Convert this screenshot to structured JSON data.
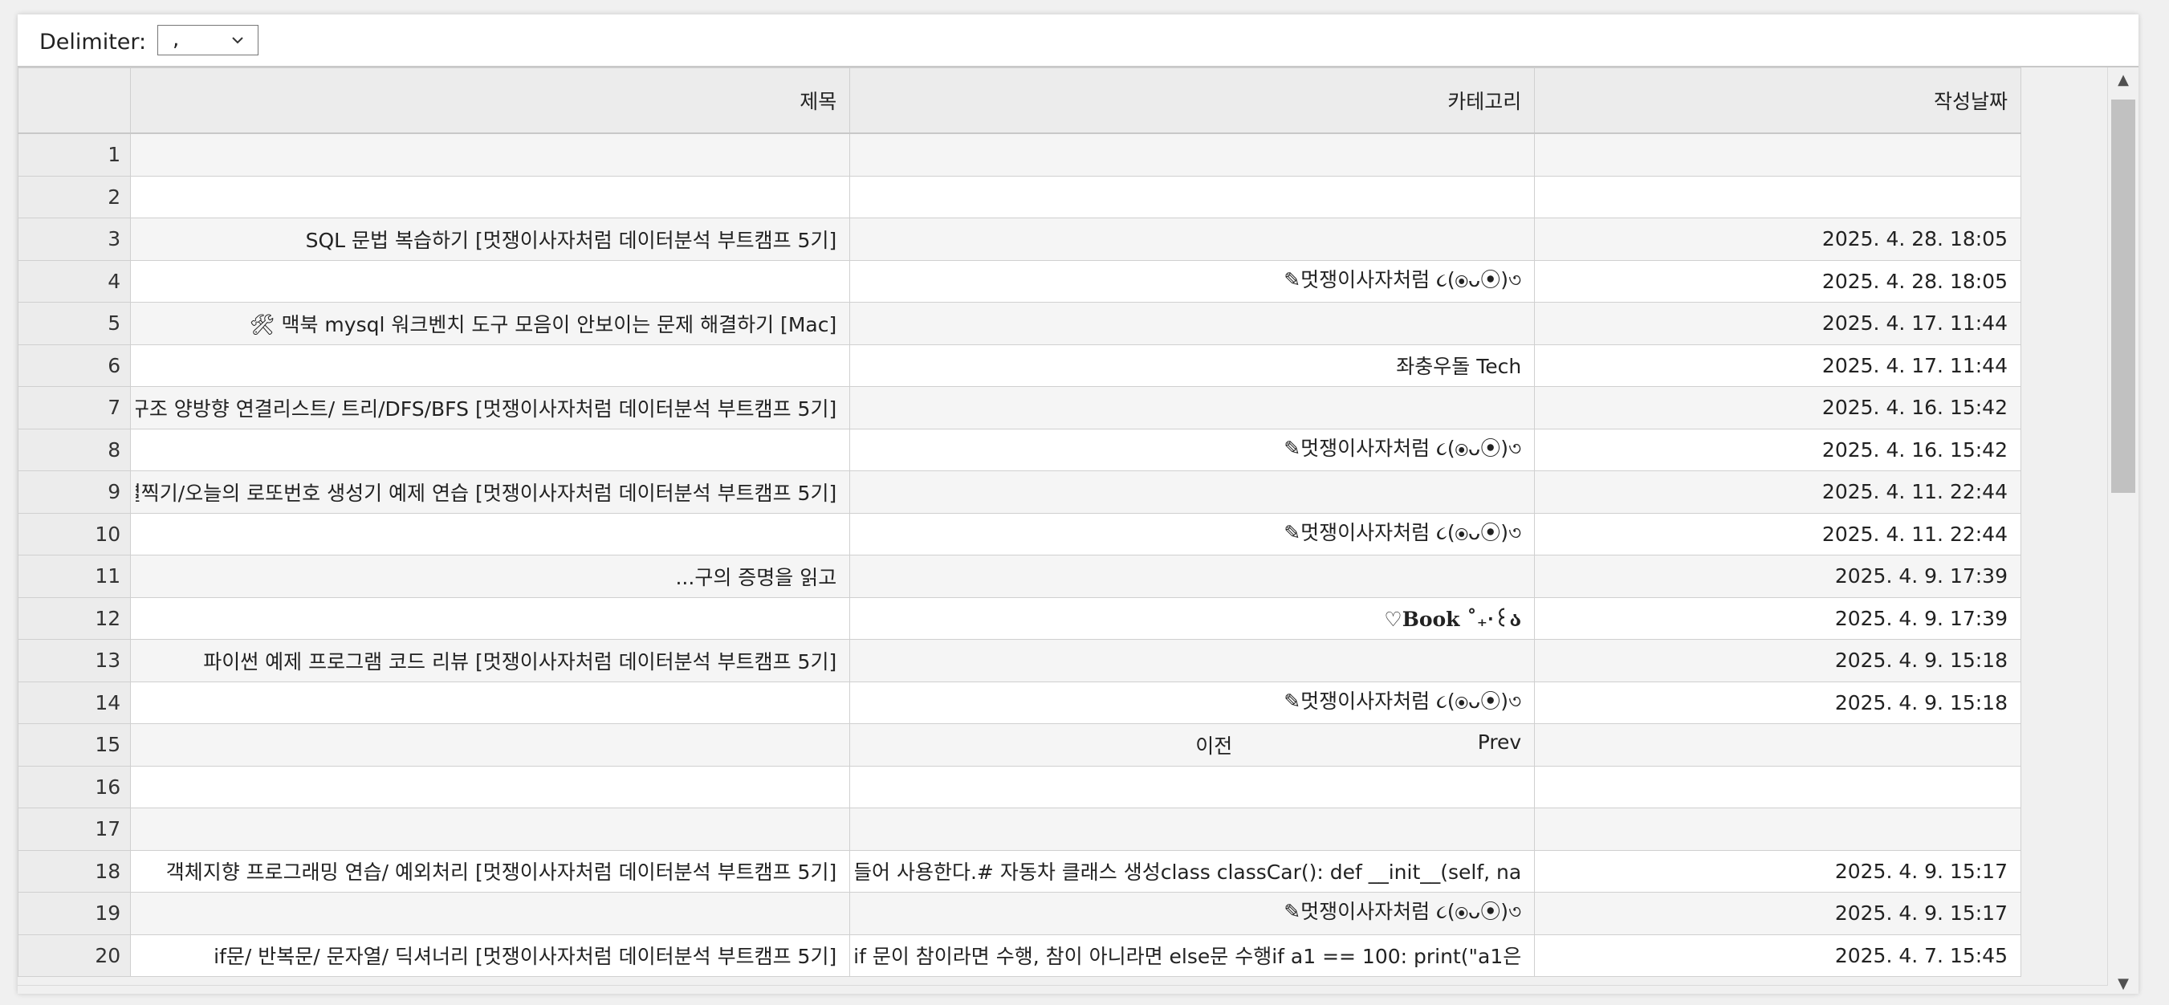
{
  "toolbar": {
    "delimiter_label": "Delimiter:",
    "delimiter_value": ","
  },
  "table": {
    "columns": [
      "제목",
      "카테고리",
      "작성날짜"
    ],
    "rows": [
      {
        "num": "1",
        "title": "",
        "category": "",
        "date": ""
      },
      {
        "num": "2",
        "title": "",
        "category": "",
        "date": ""
      },
      {
        "num": "3",
        "title": "[멋쟁이사자처럼 데이터분석 부트캠프 5기] SQL 문법 복습하기",
        "category": "",
        "date": "2025. 4. 28. 18:05"
      },
      {
        "num": "4",
        "title": "",
        "category": "멋쟁이사자처럼 ૮(⦿ᴗ⦿)৩✎",
        "date": "2025. 4. 28. 18:05"
      },
      {
        "num": "5",
        "title": "[Mac] 맥북 mysql 워크벤치 도구 모음이 안보이는 문제 해결하기 🛠",
        "category": "",
        "date": "2025. 4. 17. 11:44"
      },
      {
        "num": "6",
        "title": "",
        "category": "좌충우돌 Tech",
        "date": "2025. 4. 17. 11:44"
      },
      {
        "num": "7",
        "title": "[멋쟁이사자처럼 데이터분석 부트캠프 5기] 자료구조 양방향 연결리스트/ 트리/DFS/BFS",
        "category": "",
        "date": "2025. 4. 16. 15:42"
      },
      {
        "num": "8",
        "title": "",
        "category": "멋쟁이사자처럼 ૮(⦿ᴗ⦿)৩✎",
        "date": "2025. 4. 16. 15:42"
      },
      {
        "num": "9",
        "title": "[멋쟁이사자처럼 데이터분석 부트캠프 5기] 파이썬 별찍기/오늘의 로또번호 생성기 예제 연습",
        "category": "",
        "date": "2025. 4. 11. 22:44"
      },
      {
        "num": "10",
        "title": "",
        "category": "멋쟁이사자처럼 ૮(⦿ᴗ⦿)৩✎",
        "date": "2025. 4. 11. 22:44"
      },
      {
        "num": "11",
        "title": "구의 증명을 읽고...",
        "category": "",
        "date": "2025. 4. 9. 17:39"
      },
      {
        "num": "12",
        "title": "",
        "category": "Book ˚₊‧꒰ა♡",
        "date": "2025. 4. 9. 17:39"
      },
      {
        "num": "13",
        "title": "[멋쟁이사자처럼 데이터분석 부트캠프 5기] 파이썬 예제 프로그램 코드 리뷰",
        "category": "",
        "date": "2025. 4. 9. 15:18"
      },
      {
        "num": "14",
        "title": "",
        "category": "멋쟁이사자처럼 ૮(⦿ᴗ⦿)৩✎",
        "date": "2025. 4. 9. 15:18"
      },
      {
        "num": "15",
        "title": "",
        "category_left": "이전",
        "category": "Prev",
        "date": ""
      },
      {
        "num": "16",
        "title": "",
        "category": "",
        "date": ""
      },
      {
        "num": "17",
        "title": "",
        "category": "",
        "date": ""
      },
      {
        "num": "18",
        "title": "[멋쟁이사자처럼 데이터분석 부트캠프 5기] 객체지향 프로그래밍 연습/ 예외처리",
        "category": "를 만들어 사용한다.# 자동차 클래스 생성class classCar():    def __init__(self, na..",
        "date": "2025. 4. 9. 15:17"
      },
      {
        "num": "19",
        "title": "",
        "category": "멋쟁이사자처럼 ૮(⦿ᴗ⦿)৩✎",
        "date": "2025. 4. 9. 15:17"
      },
      {
        "num": "20",
        "title": "[멋쟁이사자처럼 데이터분석 부트캠프 5기] if문/ 반복문/ 문자열/ 딕셔너리",
        "category": "se : if 문이 참이라면 수행, 참이 아니라면 else문 수행if a1 == 100:    print(\"a1은..",
        "date": "2025. 4. 7. 15:45"
      }
    ]
  },
  "scrollbar": {
    "up_icon": "▲",
    "down_icon": "▼"
  }
}
